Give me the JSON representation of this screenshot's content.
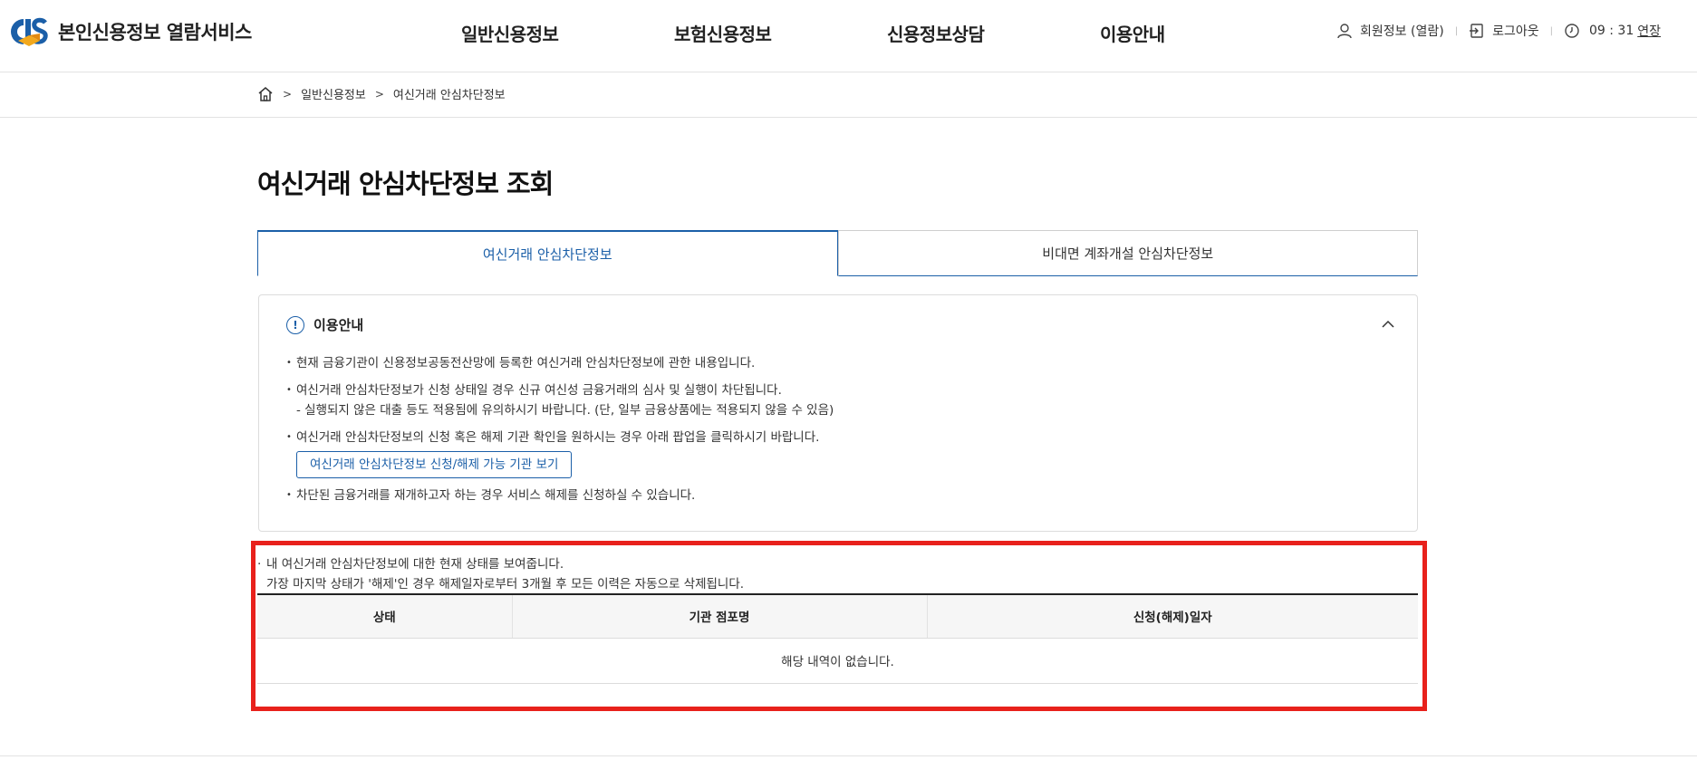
{
  "header": {
    "logo_text": "본인신용정보 열람서비스",
    "nav": [
      "일반신용정보",
      "보험신용정보",
      "신용정보상담",
      "이용안내"
    ],
    "util": {
      "member": "회원정보 (열람)",
      "logout": "로그아웃",
      "timer": "09 : 31",
      "extend": "연장"
    }
  },
  "breadcrumb": {
    "level1": "일반신용정보",
    "level2": "여신거래 안심차단정보"
  },
  "page_title": "여신거래 안심차단정보 조회",
  "tabs": [
    {
      "label": "여신거래 안심차단정보",
      "active": true
    },
    {
      "label": "비대면 계좌개설 안심차단정보",
      "active": false
    }
  ],
  "guide": {
    "title": "이용안내",
    "items": [
      "현재 금융기관이 신용정보공동전산망에 등록한 여신거래 안심차단정보에 관한 내용입니다.",
      "여신거래 안심차단정보가 신청 상태일 경우 신규 여신성 금융거래의 심사 및 실행이 차단됩니다.",
      "- 실행되지 않은 대출 등도 적용됨에 유의하시기 바랍니다. (단, 일부 금융상품에는 적용되지 않을 수 있음)",
      "여신거래 안심차단정보의 신청 혹은 해제 기관 확인을 원하시는 경우 아래 팝업을 클릭하시기 바랍니다.",
      "차단된 금융거래를 재개하고자 하는 경우 서비스 해제를 신청하실 수 있습니다."
    ],
    "institution_button": "여신거래 안심차단정보 신청/해제 가능 기관 보기"
  },
  "status": {
    "notice_line1": "내 여신거래 안심차단정보에 대한 현재 상태를 보여줍니다.",
    "notice_line2": "가장 마지막 상태가 '해제'인 경우 해제일자로부터 3개월 후 모든 이력은 자동으로 삭제됩니다.",
    "columns": [
      "상태",
      "기관 점포명",
      "신청(해제)일자"
    ],
    "empty_message": "해당 내역이 없습니다."
  },
  "colors": {
    "accent": "#1b5fa8",
    "highlight_border": "#e8211c"
  }
}
